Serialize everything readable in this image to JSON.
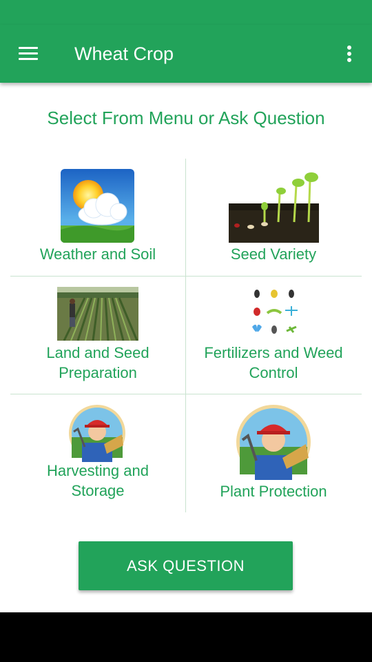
{
  "app_bar": {
    "title": "Wheat Crop",
    "menu_icon": "hamburger-menu-icon",
    "overflow_icon": "more-vert-icon"
  },
  "main": {
    "heading": "Select From Menu or Ask Question",
    "menu_items": [
      {
        "label": "Weather and Soil",
        "icon": "weather-sun-cloud-icon"
      },
      {
        "label": "Seed Variety",
        "icon": "seedling-sprouts-image"
      },
      {
        "label": "Land and Seed\nPreparation",
        "icon": "farmer-field-image"
      },
      {
        "label": "Fertilizers and Weed\nControl",
        "icon": "insects-grid-image"
      },
      {
        "label": "Harvesting and\nStorage",
        "icon": "farmer-badge-image"
      },
      {
        "label": "Plant Protection",
        "icon": "farmer-badge-image"
      }
    ],
    "ask_button": "ASK QUESTION"
  },
  "colors": {
    "primary": "#22a35a",
    "text_accent": "#22a35a",
    "divider": "#c9e3cf",
    "nav_bar": "#000000"
  }
}
